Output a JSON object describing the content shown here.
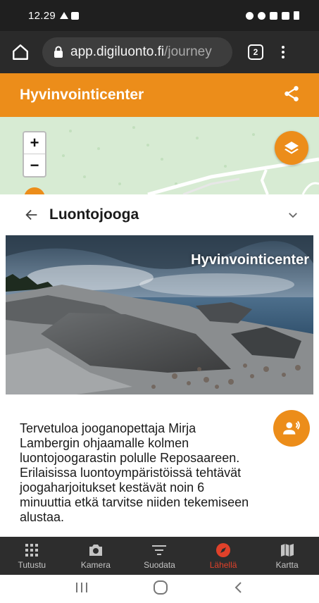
{
  "status_bar": {
    "time": "12.29"
  },
  "browser": {
    "url_host": "app.digiluonto.fi",
    "url_path": "/journey",
    "tab_count": "2"
  },
  "app_header": {
    "title": "Hyvinvointicenter"
  },
  "map": {
    "zoom_in": "+",
    "zoom_out": "−"
  },
  "section": {
    "title": "Luontojooga"
  },
  "hero": {
    "caption": "Hyvinvointicenter"
  },
  "intro": {
    "text": "Tervetuloa jooganopettaja Mirja Lambergin ohjaamalle kolmen luontojoogarastin polulle Reposaareen. Erilaisissa luontoympäristöissä tehtävät joogaharjoitukset kestävät noin 6 minuuttia etkä tarvitse niiden tekemiseen alustaa."
  },
  "bottom_nav": {
    "items": [
      {
        "label": "Tutustu",
        "icon": "grid-icon"
      },
      {
        "label": "Kamera",
        "icon": "camera-icon"
      },
      {
        "label": "Suodata",
        "icon": "filter-icon"
      },
      {
        "label": "Lähellä",
        "icon": "compass-icon"
      },
      {
        "label": "Kartta",
        "icon": "map-icon"
      }
    ],
    "active": "Lähellä"
  },
  "colors": {
    "accent": "#ec8d1a",
    "active_nav": "#e0412a",
    "nav_bg": "#2d2d2d",
    "map_bg": "#d7ebd3"
  }
}
